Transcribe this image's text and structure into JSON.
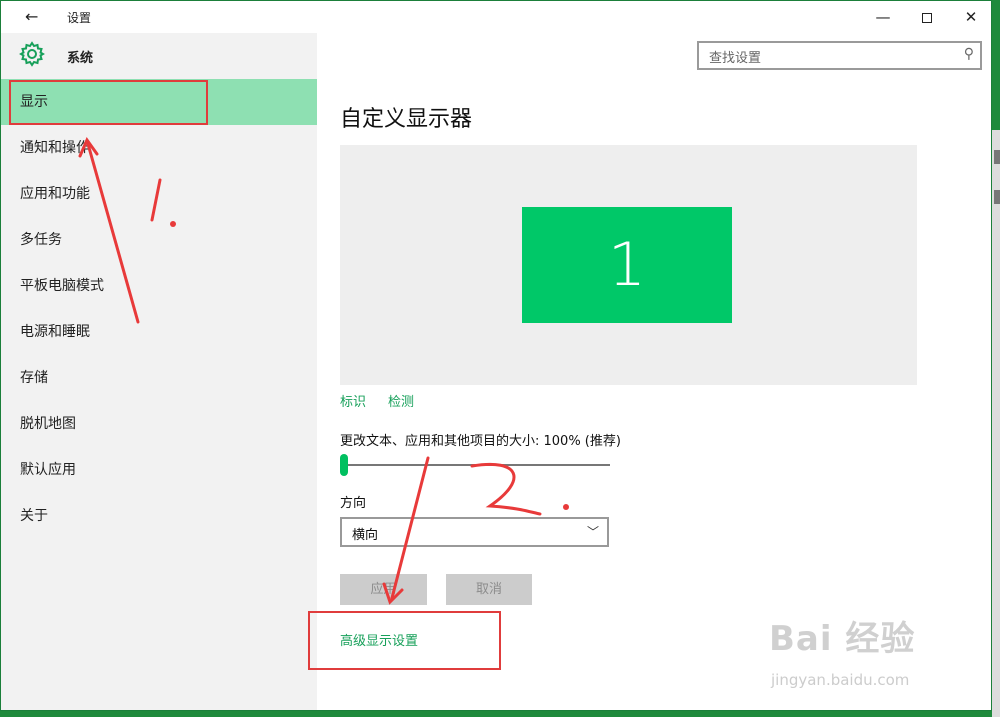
{
  "window": {
    "title": "设置",
    "back_icon": "back-arrow-icon",
    "minimize": "—",
    "close": "✕"
  },
  "header": {
    "icon": "gear-icon",
    "title": "系统",
    "accent": "#17a05a"
  },
  "search": {
    "placeholder": "查找设置",
    "icon": "search-icon"
  },
  "sidebar": {
    "items": [
      {
        "label": "显示",
        "selected": true
      },
      {
        "label": "通知和操作"
      },
      {
        "label": "应用和功能"
      },
      {
        "label": "多任务"
      },
      {
        "label": "平板电脑模式"
      },
      {
        "label": "电源和睡眠"
      },
      {
        "label": "存储"
      },
      {
        "label": "脱机地图"
      },
      {
        "label": "默认应用"
      },
      {
        "label": "关于"
      }
    ],
    "selected_color": "#8ee0b2"
  },
  "main": {
    "title": "自定义显示器",
    "monitor_number": "1",
    "monitor_color": "#00c868",
    "identify": "标识",
    "detect": "检测",
    "scale_label": "更改文本、应用和其他项目的大小: 100% (推荐)",
    "scale_value": 0,
    "orientation_label": "方向",
    "orientation_value": "横向",
    "apply": "应用",
    "cancel": "取消",
    "advanced": "高级显示设置"
  },
  "annotations": {
    "step1": "1.",
    "step2": "2.",
    "color": "#e03c3c"
  },
  "watermark": {
    "main": "Bai 经验",
    "sub": "jingyan.baidu.com"
  }
}
